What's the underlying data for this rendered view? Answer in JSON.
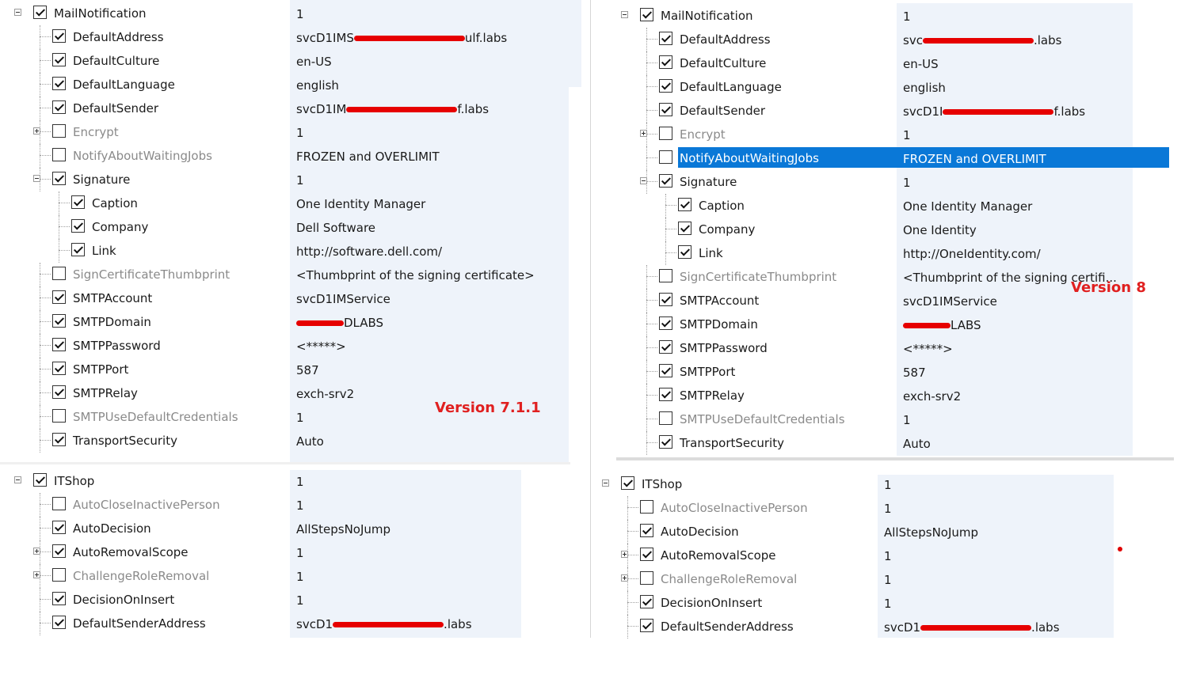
{
  "colors": {
    "selection": "#0a78d7",
    "version_label": "#e02020",
    "redaction": "#e60000",
    "value_column": "#eef3fa"
  },
  "left": {
    "version_label": "Version 7.1.1",
    "mail": [
      {
        "label": "MailNotification",
        "value": "1",
        "checked": true,
        "gray": false,
        "level": 0,
        "expander": "minus"
      },
      {
        "label": "DefaultAddress",
        "value": "svcD1IMS",
        "value_after": "ulf.labs",
        "checked": true,
        "gray": false,
        "level": 1
      },
      {
        "label": "DefaultCulture",
        "value": "en-US",
        "checked": true,
        "gray": false,
        "level": 1
      },
      {
        "label": "DefaultLanguage",
        "value": "english",
        "checked": true,
        "gray": false,
        "level": 1
      },
      {
        "label": "DefaultSender",
        "value": "svcD1IM",
        "value_after": "f.labs",
        "checked": true,
        "gray": false,
        "level": 1
      },
      {
        "label": "Encrypt",
        "value": "1",
        "checked": false,
        "gray": true,
        "level": 1,
        "expander": "plus"
      },
      {
        "label": "NotifyAboutWaitingJobs",
        "value": "FROZEN and OVERLIMIT",
        "checked": false,
        "gray": true,
        "level": 1
      },
      {
        "label": "Signature",
        "value": "1",
        "checked": true,
        "gray": false,
        "level": 1,
        "expander": "minus"
      },
      {
        "label": "Caption",
        "value": "One Identity Manager",
        "checked": true,
        "gray": false,
        "level": 2
      },
      {
        "label": "Company",
        "value": "Dell Software",
        "checked": true,
        "gray": false,
        "level": 2
      },
      {
        "label": "Link",
        "value": "http://software.dell.com/",
        "checked": true,
        "gray": false,
        "level": 2
      },
      {
        "label": "SignCertificateThumbprint",
        "value": "<Thumbprint of the signing certificate>",
        "checked": false,
        "gray": true,
        "level": 1
      },
      {
        "label": "SMTPAccount",
        "value": "svcD1IMService",
        "checked": true,
        "gray": false,
        "level": 1
      },
      {
        "label": "SMTPDomain",
        "value": "",
        "value_after": "DLABS",
        "checked": true,
        "gray": false,
        "level": 1
      },
      {
        "label": "SMTPPassword",
        "value": "<*****>",
        "checked": true,
        "gray": false,
        "level": 1
      },
      {
        "label": "SMTPPort",
        "value": "587",
        "checked": true,
        "gray": false,
        "level": 1
      },
      {
        "label": "SMTPRelay",
        "value": "exch-srv2",
        "checked": true,
        "gray": false,
        "level": 1
      },
      {
        "label": "SMTPUseDefaultCredentials",
        "value": "1",
        "checked": false,
        "gray": true,
        "level": 1
      },
      {
        "label": "TransportSecurity",
        "value": "Auto",
        "checked": true,
        "gray": false,
        "level": 1
      }
    ],
    "itshop": [
      {
        "label": "ITShop",
        "value": "1",
        "checked": true,
        "gray": false,
        "level": 0,
        "expander": "minus"
      },
      {
        "label": "AutoCloseInactivePerson",
        "value": "1",
        "checked": false,
        "gray": true,
        "level": 1
      },
      {
        "label": "AutoDecision",
        "value": "AllStepsNoJump",
        "checked": true,
        "gray": false,
        "level": 1
      },
      {
        "label": "AutoRemovalScope",
        "value": "1",
        "checked": true,
        "gray": false,
        "level": 1,
        "expander": "plus"
      },
      {
        "label": "ChallengeRoleRemoval",
        "value": "1",
        "checked": false,
        "gray": true,
        "level": 1,
        "expander": "plus"
      },
      {
        "label": "DecisionOnInsert",
        "value": "1",
        "checked": true,
        "gray": false,
        "level": 1
      },
      {
        "label": "DefaultSenderAddress",
        "value": "svcD1",
        "value_after": ".labs",
        "checked": true,
        "gray": false,
        "level": 1
      }
    ]
  },
  "right": {
    "version_label": "Version 8",
    "mail": [
      {
        "label": "MailNotification",
        "value": "1",
        "checked": true,
        "gray": false,
        "level": 0,
        "expander": "minus"
      },
      {
        "label": "DefaultAddress",
        "value": "svc",
        "value_after": ".labs",
        "checked": true,
        "gray": false,
        "level": 1
      },
      {
        "label": "DefaultCulture",
        "value": "en-US",
        "checked": true,
        "gray": false,
        "level": 1
      },
      {
        "label": "DefaultLanguage",
        "value": "english",
        "checked": true,
        "gray": false,
        "level": 1
      },
      {
        "label": "DefaultSender",
        "value": "svcD1I",
        "value_after": "f.labs",
        "checked": true,
        "gray": false,
        "level": 1
      },
      {
        "label": "Encrypt",
        "value": "1",
        "checked": false,
        "gray": true,
        "level": 1,
        "expander": "plus"
      },
      {
        "label": "NotifyAboutWaitingJobs",
        "value": "FROZEN and OVERLIMIT",
        "checked": false,
        "gray": true,
        "level": 1,
        "selected": true
      },
      {
        "label": "Signature",
        "value": "1",
        "checked": true,
        "gray": false,
        "level": 1,
        "expander": "minus"
      },
      {
        "label": "Caption",
        "value": "One Identity Manager",
        "checked": true,
        "gray": false,
        "level": 2
      },
      {
        "label": "Company",
        "value": "One Identity",
        "checked": true,
        "gray": false,
        "level": 2
      },
      {
        "label": "Link",
        "value": "http://OneIdentity.com/",
        "checked": true,
        "gray": false,
        "level": 2
      },
      {
        "label": "SignCertificateThumbprint",
        "value": "<Thumbprint of the signing certifi...",
        "checked": false,
        "gray": true,
        "level": 1
      },
      {
        "label": "SMTPAccount",
        "value": "svcD1IMService",
        "checked": true,
        "gray": false,
        "level": 1
      },
      {
        "label": "SMTPDomain",
        "value": "",
        "value_after": "LABS",
        "checked": true,
        "gray": false,
        "level": 1
      },
      {
        "label": "SMTPPassword",
        "value": "<*****>",
        "checked": true,
        "gray": false,
        "level": 1
      },
      {
        "label": "SMTPPort",
        "value": "587",
        "checked": true,
        "gray": false,
        "level": 1
      },
      {
        "label": "SMTPRelay",
        "value": "exch-srv2",
        "checked": true,
        "gray": false,
        "level": 1
      },
      {
        "label": "SMTPUseDefaultCredentials",
        "value": "1",
        "checked": false,
        "gray": true,
        "level": 1
      },
      {
        "label": "TransportSecurity",
        "value": "Auto",
        "checked": true,
        "gray": false,
        "level": 1
      }
    ],
    "itshop": [
      {
        "label": "ITShop",
        "value": "1",
        "checked": true,
        "gray": false,
        "level": 0,
        "expander": "minus"
      },
      {
        "label": "AutoCloseInactivePerson",
        "value": "1",
        "checked": false,
        "gray": true,
        "level": 1
      },
      {
        "label": "AutoDecision",
        "value": "AllStepsNoJump",
        "checked": true,
        "gray": false,
        "level": 1
      },
      {
        "label": "AutoRemovalScope",
        "value": "1",
        "checked": true,
        "gray": false,
        "level": 1,
        "expander": "plus"
      },
      {
        "label": "ChallengeRoleRemoval",
        "value": "1",
        "checked": false,
        "gray": true,
        "level": 1,
        "expander": "plus"
      },
      {
        "label": "DecisionOnInsert",
        "value": "1",
        "checked": true,
        "gray": false,
        "level": 1
      },
      {
        "label": "DefaultSenderAddress",
        "value": "svcD1",
        "value_after": ".labs",
        "checked": true,
        "gray": false,
        "level": 1
      }
    ]
  }
}
